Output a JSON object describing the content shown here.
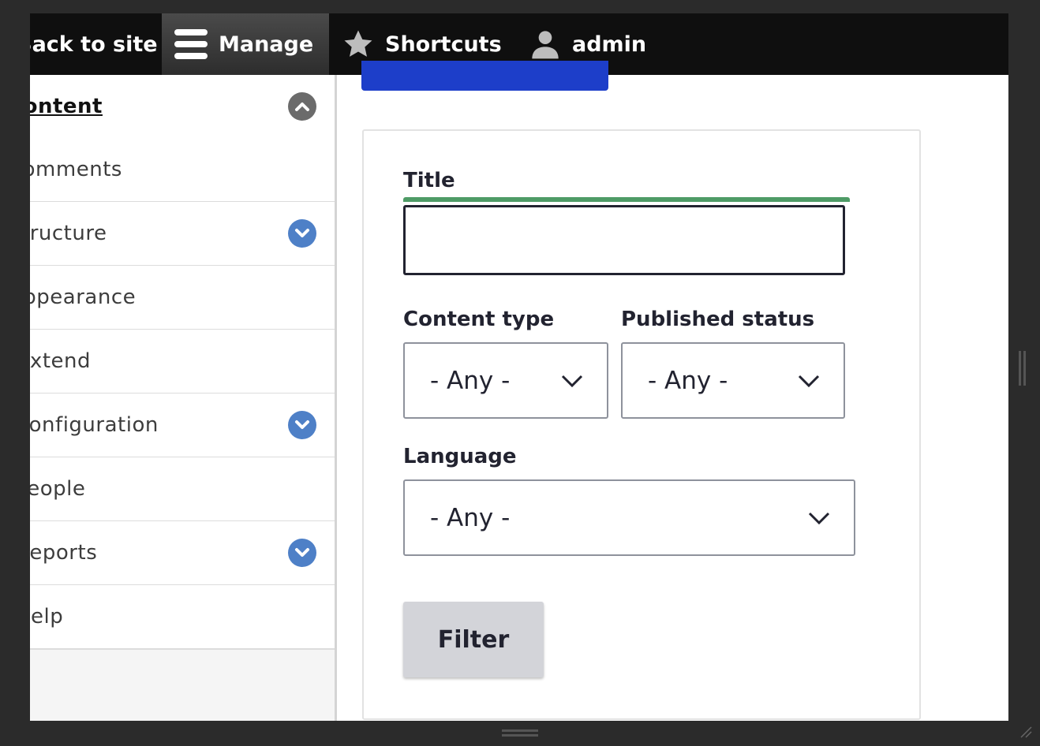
{
  "toolbar": {
    "back_label": "Back to site",
    "manage_label": "Manage",
    "shortcuts_label": "Shortcuts",
    "user_label": "admin"
  },
  "sidebar": {
    "items": [
      {
        "label": "Content",
        "active": true,
        "toggle": "chevron-up"
      },
      {
        "label": "Comments"
      },
      {
        "label": "Structure",
        "toggle": "chevron-down"
      },
      {
        "label": "Appearance"
      },
      {
        "label": "Extend"
      },
      {
        "label": "Configuration",
        "toggle": "chevron-down"
      },
      {
        "label": "People"
      },
      {
        "label": "Reports",
        "toggle": "chevron-down"
      },
      {
        "label": "Help"
      }
    ]
  },
  "filters": {
    "title_label": "Title",
    "title_value": "",
    "content_type_label": "Content type",
    "content_type_value": "- Any -",
    "published_label": "Published status",
    "published_value": "- Any -",
    "language_label": "Language",
    "language_value": "- Any -",
    "filter_button": "Filter"
  },
  "colors": {
    "toolbar_bg": "#0f0f0f",
    "primary_button": "#1d3ec9",
    "focus_green": "#4e9b66",
    "chevron_blue": "#4e80c7"
  }
}
